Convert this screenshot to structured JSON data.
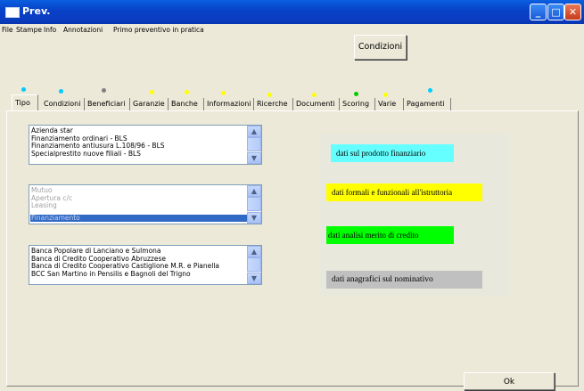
{
  "window": {
    "title": "Prev.",
    "minimize_glyph": "_",
    "maximize_glyph": "□",
    "close_glyph": "✕"
  },
  "menu": [
    "File",
    "Stampe",
    "Info",
    "Annotazioni",
    "Primo preventivo in pratica"
  ],
  "condizioni_button": "Condizioni",
  "tabs": [
    {
      "label": "Tipo",
      "dot_color": "#00ccff",
      "active": true
    },
    {
      "label": "Condizioni",
      "dot_color": "#00ccff"
    },
    {
      "label": "Beneficiari",
      "dot_color": "#808080"
    },
    {
      "label": "Garanzie",
      "dot_color": "#ffff00"
    },
    {
      "label": "Banche",
      "dot_color": "#ffff00"
    },
    {
      "label": "Informazioni",
      "dot_color": "#ffff00"
    },
    {
      "label": "Ricerche",
      "dot_color": "#ffff00"
    },
    {
      "label": "Documenti",
      "dot_color": "#ffff00"
    },
    {
      "label": "Scoring",
      "dot_color": "#00cc00"
    },
    {
      "label": "Varie",
      "dot_color": "#ffff00"
    },
    {
      "label": "Pagamenti",
      "dot_color": "#00ccff"
    }
  ],
  "list_aziende": [
    "Azienda star",
    "Finanziamento ordinari - BLS",
    "Finanziamento antiusura L.108/96 - BLS",
    "Specialprestito nuove filiali - BLS"
  ],
  "list_tipi": {
    "items": [
      "Mutuo",
      "Apertura c/c",
      "Leasing"
    ],
    "selected": "Finanziamento"
  },
  "list_banche": [
    "Banca Popolare di Lanciano e Sulmona",
    "Banca di Credito Cooperativo Abruzzese",
    "Banca di Credito Cooperativo Castiglione M.R. e Pianella",
    "BCC San Martino in Pensilis e Bagnoli del Trigno"
  ],
  "info_labels": [
    {
      "text": "dati sul prodotto finanziario",
      "color": "#66ffff"
    },
    {
      "text": "dati formali e funzionali all'istruttoria",
      "color": "#ffff00"
    },
    {
      "text": "dati analisi merito di credito",
      "color": "#00ff00"
    },
    {
      "text": "dati anagrafici sul nominativo",
      "color": "#c0c0c0"
    }
  ],
  "ok_button": "Ok"
}
